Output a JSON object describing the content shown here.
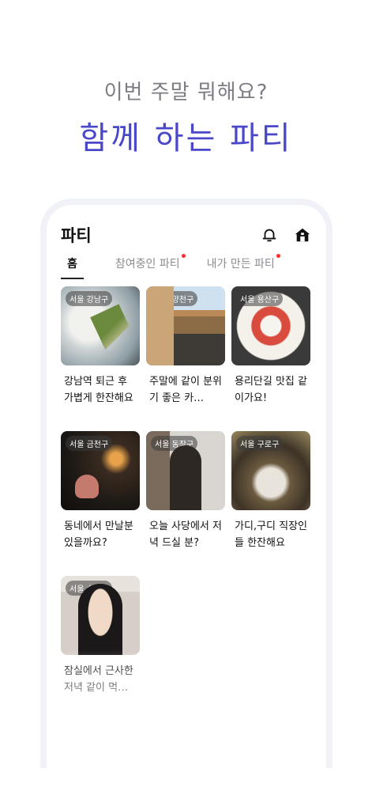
{
  "hero": {
    "subtitle": "이번 주말 뭐해요?",
    "title": "함께 하는 파티"
  },
  "app": {
    "title": "파티",
    "icons": {
      "notification": "bell-icon",
      "home": "home-icon"
    }
  },
  "tabs": [
    {
      "label": "홈",
      "active": true,
      "new_dot": false
    },
    {
      "label": "참여중인 파티",
      "active": false,
      "new_dot": true
    },
    {
      "label": "내가 만든 파티",
      "active": false,
      "new_dot": true
    }
  ],
  "parties": [
    {
      "location": "서울 강남구",
      "title": "강남역 퇴근 후 가볍게 한잔해요"
    },
    {
      "location": "서울 양천구",
      "title": "주말에 같이 분위기 좋은 카…"
    },
    {
      "location": "서울 용산구",
      "title": "용리단길 맛집 같이가요!"
    },
    {
      "location": "서울 금천구",
      "title": "동네에서 만날분 있을까요?"
    },
    {
      "location": "서울 동작구",
      "title": "오늘 사당에서 저녁 드실 분?"
    },
    {
      "location": "서울 구로구",
      "title": "가디,구디 직장인들 한잔해요"
    },
    {
      "location": "서울 송파구",
      "title": "잠실에서 근사한 저녁 같이 먹…"
    }
  ],
  "colors": {
    "accent": "#4a47c9",
    "subtitle": "#7d7d85",
    "badge_dot": "#ff2d2d",
    "frame": "#f1f2f7"
  }
}
